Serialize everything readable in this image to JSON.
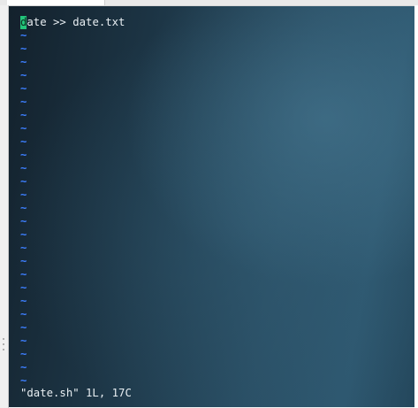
{
  "editor": {
    "cursor_char": "d",
    "first_line_rest": "ate >> date.txt",
    "empty_line_marker": "~",
    "empty_line_count": 27
  },
  "status_line": "\"date.sh\" 1L, 17C",
  "colors": {
    "cursor": "#22c47a",
    "tilde": "#3d7fff",
    "text": "#e8eef2"
  }
}
